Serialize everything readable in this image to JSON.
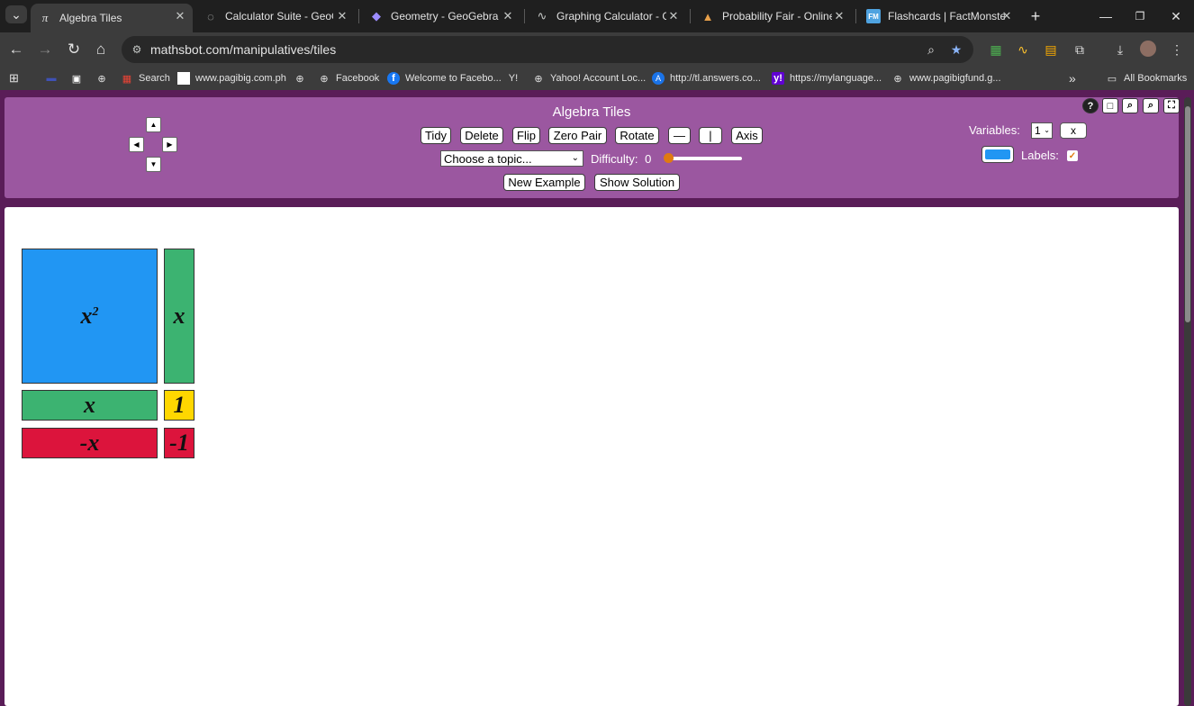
{
  "browser": {
    "tabs": [
      {
        "title": "Algebra Tiles",
        "icon": "pi-icon",
        "active": true
      },
      {
        "title": "Calculator Suite - GeoGebra",
        "icon": "geogebra-icon",
        "active": false
      },
      {
        "title": "Geometry - GeoGebra",
        "icon": "geogebra-icon",
        "active": false
      },
      {
        "title": "Graphing Calculator - GeoGebra",
        "icon": "graph-icon",
        "active": false
      },
      {
        "title": "Probability Fair - Online Pr",
        "icon": "fair-icon",
        "active": false
      },
      {
        "title": "Flashcards | FactMonster",
        "icon": "fm-icon",
        "active": false
      }
    ],
    "url": "mathsbot.com/manipulatives/tiles",
    "bookmarks": [
      {
        "label": "Search"
      },
      {
        "label": "www.pagibig.com.ph"
      },
      {
        "label": "Facebook"
      },
      {
        "label": "Welcome to Facebo..."
      },
      {
        "label": "Yahoo! Account Loc..."
      },
      {
        "label": "http://tl.answers.co..."
      },
      {
        "label": "https://mylanguage..."
      },
      {
        "label": "www.pagibigfund.g..."
      }
    ],
    "all_bookmarks": "All Bookmarks",
    "colors": {
      "accent": "#8ab4f8",
      "star": "#8ab4f8"
    }
  },
  "app": {
    "title": "Algebra Tiles",
    "buttons": {
      "tidy": "Tidy",
      "delete": "Delete",
      "flip": "Flip",
      "zero_pair": "Zero Pair",
      "rotate": "Rotate",
      "horizontal": "—",
      "vertical": "|",
      "axis": "Axis",
      "new_example": "New Example",
      "show_solution": "Show Solution"
    },
    "topic_select": "Choose a topic...",
    "difficulty_label": "Difficulty:",
    "difficulty_value": "0",
    "variables_label": "Variables:",
    "variables_value": "1",
    "variable_name": "x",
    "labels_label": "Labels:",
    "labels_checked": true,
    "colors": {
      "panel": "#9b57a0",
      "background": "#5a1d58",
      "slider_thumb": "#e07a10"
    }
  },
  "tiles": [
    {
      "label": "x",
      "sup": "2",
      "color": "#2196f3",
      "kind": "x-squared"
    },
    {
      "label": "x",
      "sup": "",
      "color": "#3cb371",
      "kind": "x-vertical"
    },
    {
      "label": "x",
      "sup": "",
      "color": "#3cb371",
      "kind": "x-horizontal"
    },
    {
      "label": "1",
      "sup": "",
      "color": "#ffd700",
      "kind": "unit"
    },
    {
      "label": "-x",
      "sup": "",
      "color": "#dc143c",
      "kind": "neg-x"
    },
    {
      "label": "-1",
      "sup": "",
      "color": "#dc143c",
      "kind": "neg-unit"
    }
  ]
}
